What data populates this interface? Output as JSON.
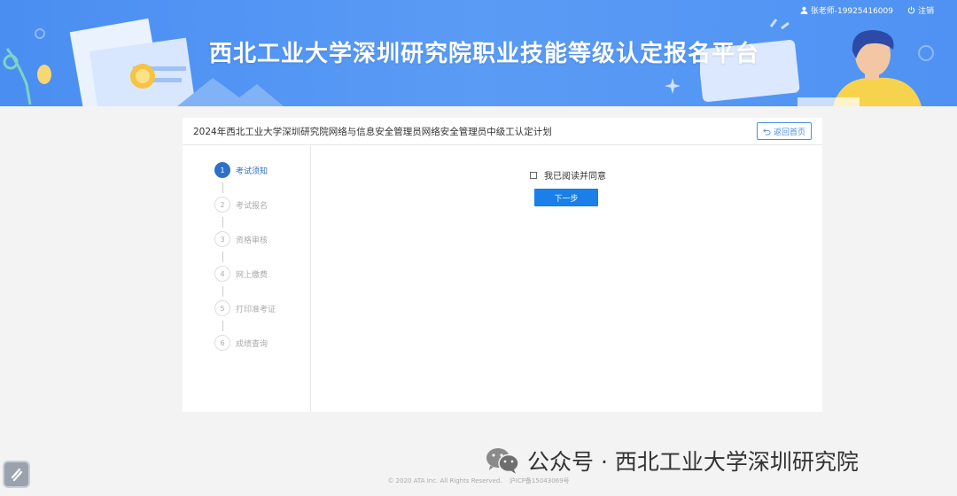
{
  "header": {
    "title": "西北工业大学深圳研究院职业技能等级认定报名平台",
    "user": "张老师-19925416009",
    "logout": "注销",
    "user_icon": "user-icon",
    "logout_icon": "power-icon"
  },
  "card": {
    "title": "2024年西北工业大学深圳研究院网络与信息安全管理员网络安全管理员中级工认定计划",
    "home_button": "返回首页"
  },
  "steps": [
    {
      "num": "1",
      "label": "考试须知"
    },
    {
      "num": "2",
      "label": "考试报名"
    },
    {
      "num": "3",
      "label": "资格审核"
    },
    {
      "num": "4",
      "label": "网上缴费"
    },
    {
      "num": "5",
      "label": "打印准考证"
    },
    {
      "num": "6",
      "label": "成绩查询"
    }
  ],
  "content": {
    "agree_label": "我已阅读并同意",
    "next_button": "下一步"
  },
  "watermark": {
    "text": "公众号 · 西北工业大学深圳研究院"
  },
  "footer": {
    "copyright": "© 2020 ATA Inc. All Rights Reserved.",
    "icp": "沪ICP备15043069号"
  },
  "colors": {
    "banner": "#4a8ef2",
    "accent": "#1a7fe8",
    "active_step": "#2f6fc8"
  }
}
